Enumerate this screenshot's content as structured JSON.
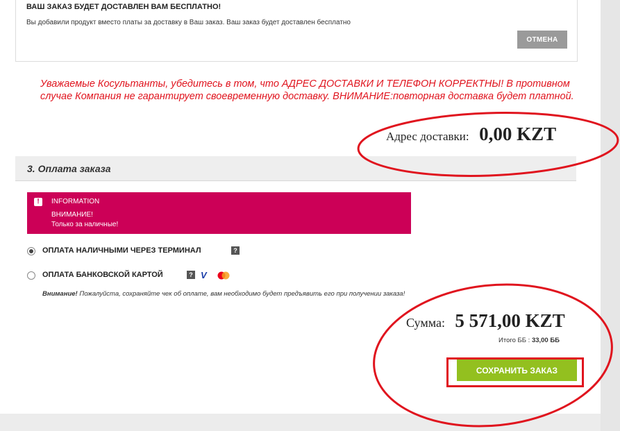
{
  "notice": {
    "title": "ВАШ ЗАКАЗ БУДЕТ ДОСТАВЛЕН ВАМ БЕСПЛАТНО!",
    "text": "Вы добавили продукт вместо платы за доставку в Ваш заказ. Ваш заказ будет доставлен бесплатно",
    "cancel_label": "ОТМЕНА"
  },
  "warning": "Уважаемые Косультанты, убедитесь в том, что АДРЕС ДОСТАВКИ И ТЕЛЕФОН КОРРЕКТНЫ! В противном случае Компания не гарантирует своевременную доставку. ВНИМАНИЕ:повторная доставка будет платной.",
  "delivery": {
    "label": "Адрес доставки:",
    "value": "0,00 KZT"
  },
  "section": {
    "title": "3. Оплата заказа"
  },
  "info": {
    "heading": "INFORMATION",
    "line1": "ВНИМАНИЕ!",
    "line2": "Только за наличные!"
  },
  "payment_options": [
    {
      "label": "ОПЛАТА НАЛИЧНЫМИ ЧЕРЕЗ ТЕРМИНАЛ",
      "selected": true
    },
    {
      "label": "ОПЛАТА БАНКОВСКОЙ КАРТОЙ",
      "selected": false
    }
  ],
  "payment_note": {
    "bold": "Внимание!",
    "text": " Пожалуйста, сохраняйте чек об оплате, вам необходимо будет предъявить его при получении заказа!"
  },
  "total": {
    "label": "Сумма:",
    "value": "5 571,00 KZT",
    "bonus_label": "Итого ББ : ",
    "bonus_value": "33,00 ББ"
  },
  "save_label": "СОХРАНИТЬ ЗАКАЗ",
  "icons": {
    "help": "question-mark-icon",
    "info": "exclamation-icon",
    "visa": "visa-icon",
    "mastercard": "mastercard-icon"
  },
  "colors": {
    "warning": "#e0141e",
    "info_bg": "#cc0057",
    "save_button": "#93c01f",
    "annotation": "#e0141e"
  }
}
